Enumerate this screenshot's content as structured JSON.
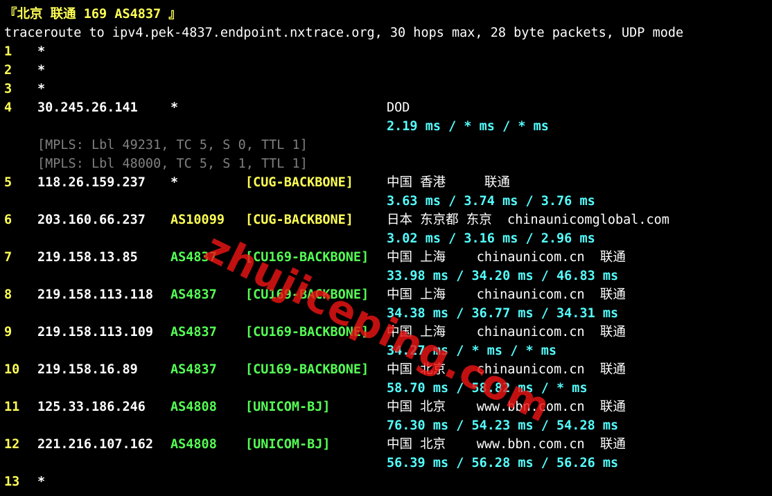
{
  "header": {
    "title": "『北京 联通 169 AS4837 』",
    "command": "traceroute to ipv4.pek-4837.endpoint.nxtrace.org, 30 hops max, 28 byte packets, UDP mode"
  },
  "hops": [
    {
      "num": "1",
      "star": "*"
    },
    {
      "num": "2",
      "star": "*"
    },
    {
      "num": "3",
      "star": "*"
    },
    {
      "num": "4",
      "ip": "30.245.26.141",
      "as": "*",
      "as_color": "white",
      "net": "",
      "net_color": "white",
      "geo": "DOD",
      "rtt": "2.19 ms / * ms / * ms",
      "mpls": [
        "[MPLS: Lbl 49231, TC 5, S 0, TTL 1]",
        "[MPLS: Lbl 48000, TC 5, S 1, TTL 1]"
      ]
    },
    {
      "num": "5",
      "ip": "118.26.159.237",
      "as": "*",
      "as_color": "white",
      "net": "[CUG-BACKBONE]",
      "net_color": "yellow",
      "geo": "中国 香港     联通",
      "rtt": "3.63 ms / 3.74 ms / 3.76 ms"
    },
    {
      "num": "6",
      "ip": "203.160.66.237",
      "as": "AS10099",
      "as_color": "yellow",
      "net": "[CUG-BACKBONE]",
      "net_color": "yellow",
      "geo": "日本 东京都 东京  chinaunicomglobal.com",
      "rtt": "3.02 ms / 3.16 ms / 2.96 ms"
    },
    {
      "num": "7",
      "ip": "219.158.13.85",
      "as": "AS4837",
      "as_color": "green",
      "net": "[CU169-BACKBONE]",
      "net_color": "green",
      "geo": "中国 上海    chinaunicom.cn  联通",
      "rtt": "33.98 ms / 34.20 ms / 46.83 ms"
    },
    {
      "num": "8",
      "ip": "219.158.113.118",
      "as": "AS4837",
      "as_color": "green",
      "net": "[CU169-BACKBONE]",
      "net_color": "green",
      "geo": "中国 上海    chinaunicom.cn  联通",
      "rtt": "34.38 ms / 36.77 ms / 34.31 ms"
    },
    {
      "num": "9",
      "ip": "219.158.113.109",
      "as": "AS4837",
      "as_color": "green",
      "net": "[CU169-BACKBONE]",
      "net_color": "green",
      "geo": "中国 上海    chinaunicom.cn  联通",
      "rtt": "34.27 ms / * ms / * ms"
    },
    {
      "num": "10",
      "ip": "219.158.16.89",
      "as": "AS4837",
      "as_color": "green",
      "net": "[CU169-BACKBONE]",
      "net_color": "green",
      "geo": "中国 北京    chinaunicom.cn  联通",
      "rtt": "58.70 ms / 58.82 ms / * ms"
    },
    {
      "num": "11",
      "ip": "125.33.186.246",
      "as": "AS4808",
      "as_color": "green",
      "net": "[UNICOM-BJ]",
      "net_color": "green",
      "geo": "中国 北京    www.bbn.com.cn  联通",
      "rtt": "76.30 ms / 54.23 ms / 54.28 ms"
    },
    {
      "num": "12",
      "ip": "221.216.107.162",
      "as": "AS4808",
      "as_color": "green",
      "net": "[UNICOM-BJ]",
      "net_color": "green",
      "geo": "中国 北京    www.bbn.com.cn  联通",
      "rtt": "56.39 ms / 56.28 ms / 56.26 ms"
    },
    {
      "num": "13",
      "star": "*"
    }
  ],
  "watermark": {
    "text": "zhujiceping.com"
  }
}
